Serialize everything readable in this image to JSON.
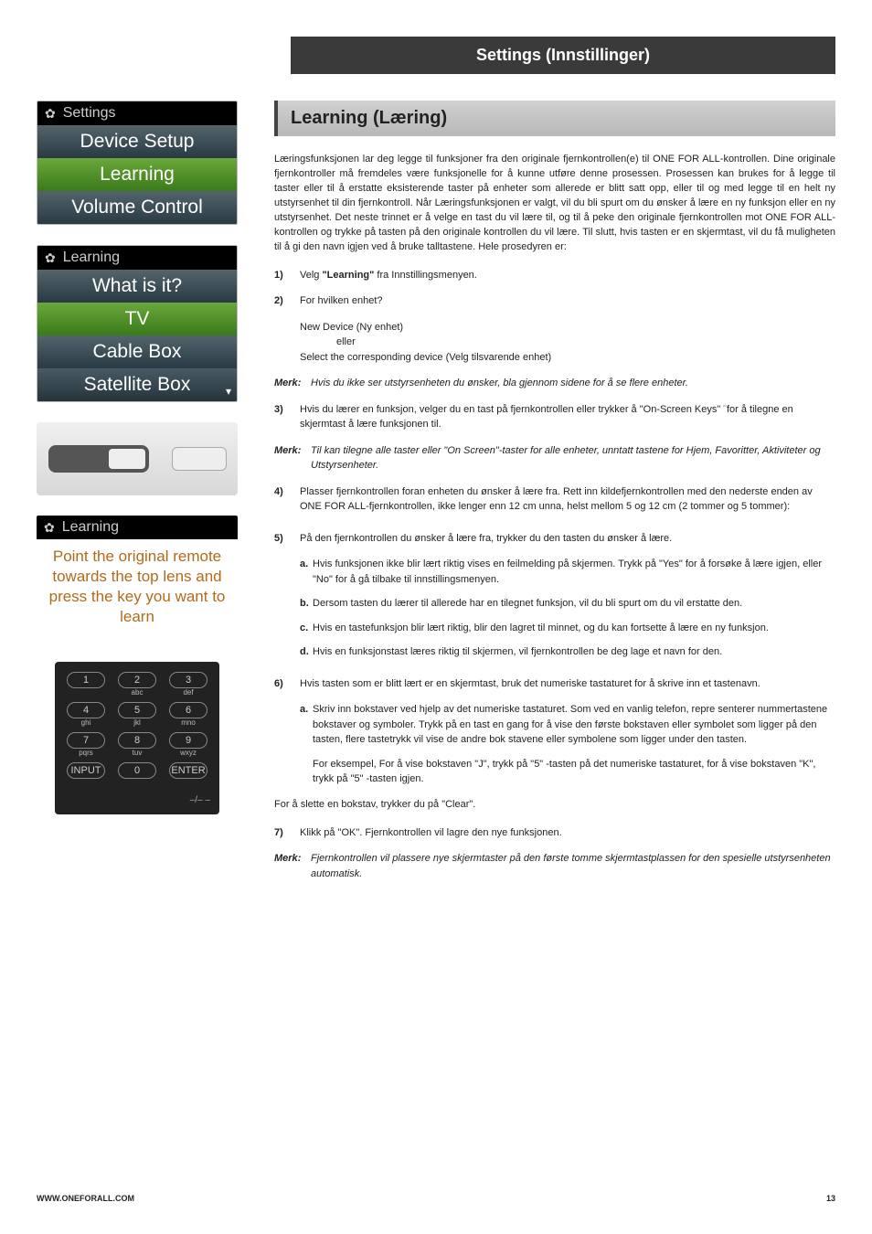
{
  "header": {
    "tab": "Settings (Innstillinger)"
  },
  "screen1": {
    "title": "Settings",
    "row1": "Device Setup",
    "row2": "Learning",
    "row3": "Volume Control"
  },
  "screen2": {
    "title": "Learning",
    "row1": "What is it?",
    "row2": "TV",
    "row3": "Cable Box",
    "row4": "Satellite Box"
  },
  "screen3": {
    "title": "Learning",
    "prompt": "Point the original remote towards the top lens and press the key you want to learn"
  },
  "keypad": {
    "keys": [
      {
        "main": "1",
        "sub": ""
      },
      {
        "main": "2",
        "sub": "abc"
      },
      {
        "main": "3",
        "sub": "def"
      },
      {
        "main": "4",
        "sub": "ghi"
      },
      {
        "main": "5",
        "sub": "jkl"
      },
      {
        "main": "6",
        "sub": "mno"
      },
      {
        "main": "7",
        "sub": "pqrs"
      },
      {
        "main": "8",
        "sub": "tuv"
      },
      {
        "main": "9",
        "sub": "wxyz"
      },
      {
        "main": "INPUT",
        "sub": ""
      },
      {
        "main": "0",
        "sub": ""
      },
      {
        "main": "ENTER",
        "sub": ""
      }
    ],
    "bar": "–/– –"
  },
  "main": {
    "section_title": "Learning (Læring)",
    "intro": "Læringsfunksjonen lar deg legge til funksjoner fra den originale fjernkontrollen(e) til ONE FOR ALL-kontrollen. Dine originale fjernkontroller må fremdeles være funksjonelle for å kunne utføre denne prosessen. Prosessen kan brukes for å legge til taster eller til å erstatte eksisterende taster på enheter som allerede er blitt satt opp, eller til og med legge til en helt ny utstyrsenhet til din fjernkontroll.  Når Læringsfunksjonen er valgt, vil du bli spurt om du ønsker å lære en ny funksjon eller en ny utstyrsenhet.  Det neste trinnet er å velge en tast du vil lære til, og til å peke den originale fjernkontrollen mot ONE FOR ALL-kontrollen og trykke på tasten på den originale kontrollen du vil lære. Til slutt, hvis tasten er en skjermtast, vil du få muligheten til å gi den navn igjen ved å bruke talltastene. Hele prosedyren er:",
    "steps": {
      "s1": {
        "num": "1)",
        "text_pre": "Velg ",
        "bold": "\"Learning\"",
        "text_post": " fra Innstillingsmenyen."
      },
      "s2": {
        "num": "2)",
        "text": "For hvilken enhet?"
      },
      "s2_sub1": "New Device (Ny enhet)",
      "s2_sub2": "eller",
      "s2_sub3": "Select the corresponding device (Velg tilsvarende enhet)",
      "merk1": "Hvis du ikke ser utstyrsenheten du ønsker, bla gjennom sidene for å se flere enheter.",
      "s3": {
        "num": "3)",
        "text": "Hvis du lærer en funksjon, velger du en tast på fjernkontrollen eller trykker å \"On-Screen Keys\" ¨for å tilegne en skjermtast å lære funksjonen til."
      },
      "merk2": "Til kan tilegne alle taster eller \"On Screen\"-taster for alle enheter, unntatt tastene for Hjem, Favoritter, Aktiviteter og Utstyrsenheter.",
      "s4": {
        "num": "4)",
        "text": "Plasser fjernkontrollen foran enheten du ønsker å lære fra. Rett inn kildefjernkontrollen med den nederste enden av ONE FOR ALL-fjernkontrollen, ikke lenger enn 12 cm unna, helst mellom 5 og 12 cm (2 tommer og 5 tommer):"
      },
      "s5": {
        "num": "5)",
        "text": "På den fjernkontrollen du ønsker å lære fra, trykker du den tasten du ønsker å lære."
      },
      "s5a": {
        "letter": "a.",
        "text": "Hvis funksjonen ikke blir lært riktig vises en feilmelding på skjermen.  Trykk på \"Yes\" for å forsøke å lære igjen, eller \"No\" for å gå tilbake til innstillingsmenyen."
      },
      "s5b": {
        "letter": "b.",
        "text": "Dersom tasten du lærer til allerede har en tilegnet funksjon, vil du bli spurt om du vil erstatte den."
      },
      "s5c": {
        "letter": "c.",
        "text": "Hvis en tastefunksjon blir lært riktig, blir den lagret til minnet, og du kan fortsette å lære en ny funksjon."
      },
      "s5d": {
        "letter": "d.",
        "text": "Hvis en funksjonstast læres riktig til skjermen, vil fjernkontrollen be deg lage et navn for den."
      },
      "s6": {
        "num": "6)",
        "text": "Hvis tasten som er blitt lært er en skjermtast, bruk det numeriske tastaturet for å skrive inn et tastenavn."
      },
      "s6a": {
        "letter": "a.",
        "text": "Skriv inn bokstaver ved hjelp av det numeriske tastaturet. Som ved en vanlig telefon, repre senterer nummertastene bokstaver og symboler. Trykk på en tast en gang for å vise den første bokstaven eller symbolet som ligger på den tasten, flere tastetrykk vil vise de andre bok stavene eller symbolene som ligger under den tasten."
      },
      "s6a2": "For eksempel, For å vise bokstaven \"J\", trykk på \"5\" -tasten på det numeriske tastaturet, for å vise bokstaven \"K\", trykk på \"5\" -tasten igjen.",
      "clear": "For å slette en bokstav, trykker du på \"Clear\".",
      "s7": {
        "num": "7)",
        "text": "Klikk på \"OK\". Fjernkontrollen vil lagre den nye funksjonen."
      },
      "merk3": "Fjernkontrollen vil plassere nye skjermtaster på den første tomme skjermtastplassen for den spesielle utstyrsenheten automatisk.",
      "merk_label": "Merk"
    }
  },
  "footer": {
    "url": "WWW.ONEFORALL.COM",
    "page": "13"
  }
}
